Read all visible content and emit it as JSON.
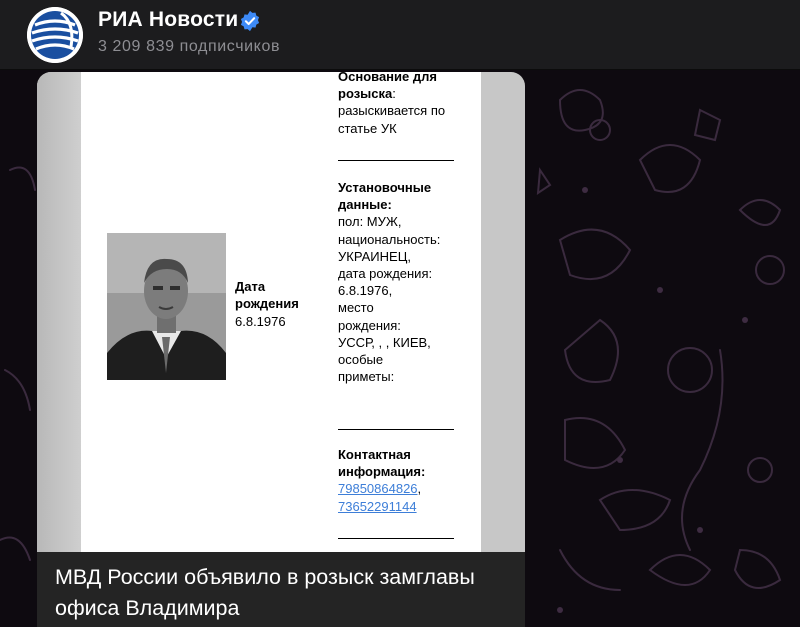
{
  "header": {
    "channel_name": "РИА Новости",
    "subscribers": "3 209 839 подписчиков",
    "avatar_icon": "ria-globe-logo",
    "verified_icon": "verified-badge-icon",
    "accent_color": "#3d8af7"
  },
  "message": {
    "document": {
      "photo": "wanted-person-photo",
      "dob_label": "Дата рождения",
      "dob_value": "6.8.1976",
      "reason_label": "Основание для розыска",
      "reason_colon": ":",
      "reason_text": "разыскивается по статье УК",
      "details_label": "Установочные данные:",
      "details_lines": [
        "пол: МУЖ,",
        "национальность:",
        "УКРАИНЕЦ,",
        "дата рождения:",
        "6.8.1976,",
        "место",
        "рождения:",
        "УССР, , , КИЕВ,",
        "особые",
        "приметы:"
      ],
      "contact_label": "Контактная информация:",
      "phone_1": "79850864826",
      "phone_1_suffix": ",",
      "phone_2": "73652291144"
    },
    "caption": "МВД России объявило в розыск замглавы офиса Владимира"
  }
}
